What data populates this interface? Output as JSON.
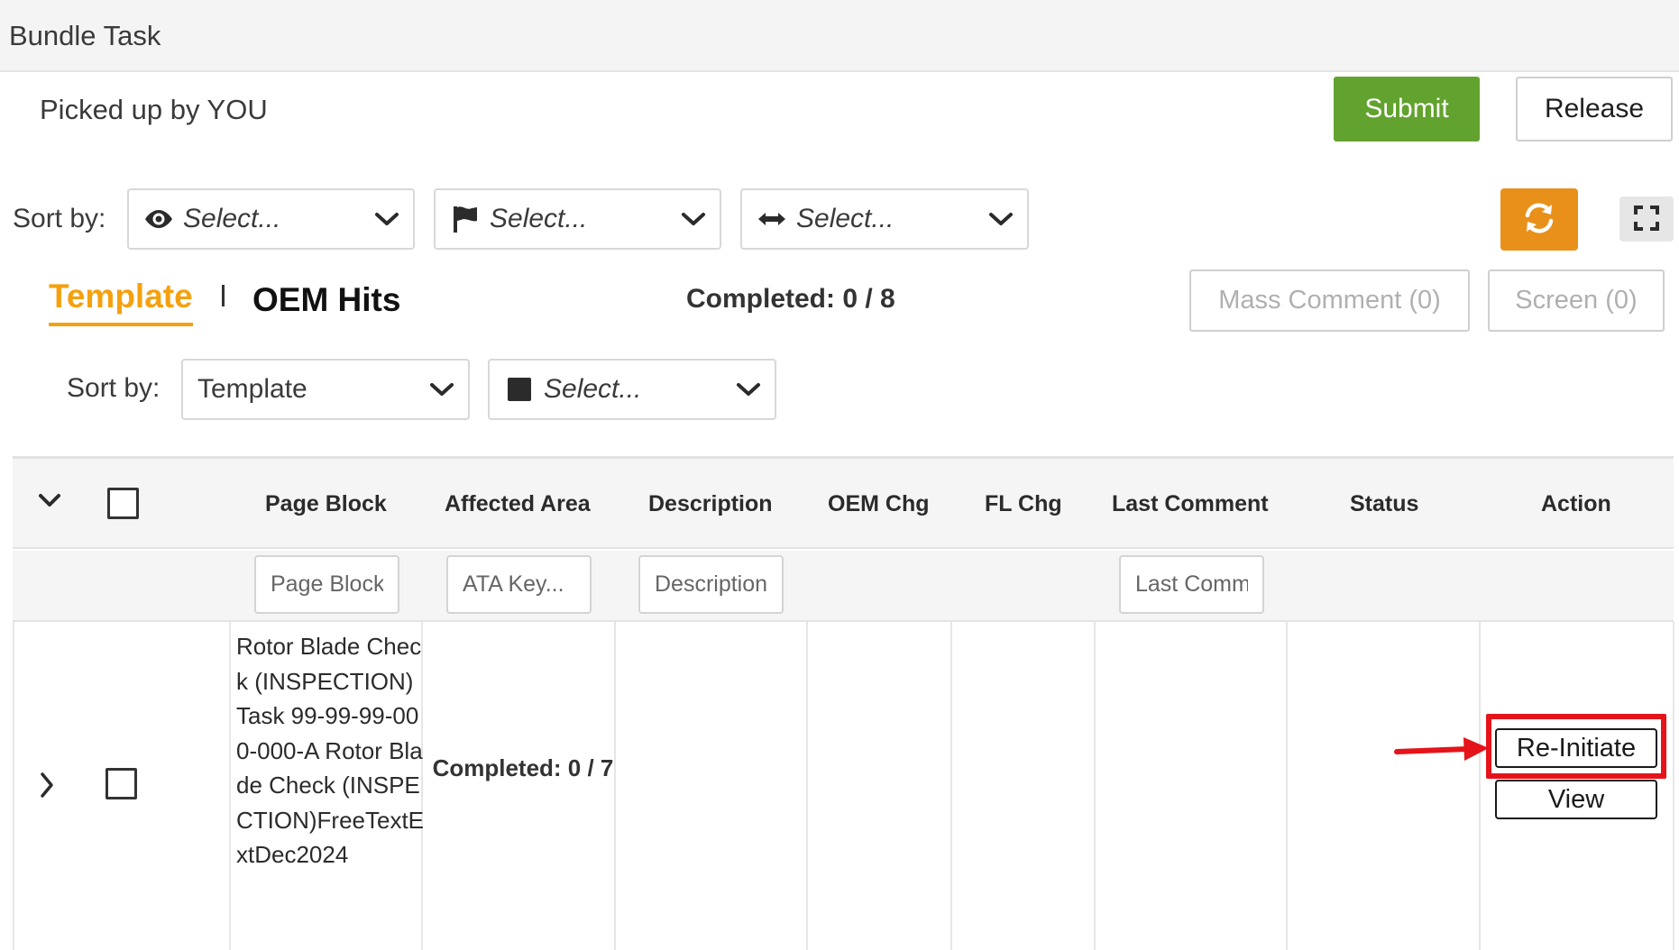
{
  "header": {
    "title": "Bundle Task"
  },
  "status": {
    "picked_up": "Picked up by YOU"
  },
  "actions": {
    "submit": "Submit",
    "release": "Release"
  },
  "sort_top": {
    "label": "Sort by:",
    "selects": [
      {
        "icon": "eye-icon",
        "value": "Select..."
      },
      {
        "icon": "flag-icon",
        "value": "Select..."
      },
      {
        "icon": "horizontal-arrows-icon",
        "value": "Select..."
      }
    ]
  },
  "tabs": [
    {
      "label": "Template",
      "active": true
    },
    {
      "label": "OEM Hits",
      "active": false
    }
  ],
  "completed_summary": "Completed: 0 / 8",
  "bulk_actions": {
    "mass_comment": "Mass Comment (0)",
    "screen": "Screen (0)"
  },
  "sort_secondary": {
    "label": "Sort by:",
    "template_select": "Template",
    "color_select": "Select..."
  },
  "table": {
    "columns": [
      "Page Block",
      "Affected Area",
      "Description",
      "OEM Chg",
      "FL Chg",
      "Last Comment",
      "Status",
      "Action"
    ],
    "filters": {
      "page_block": "Page Block",
      "affected_area": "ATA Key...",
      "description": "Description",
      "last_comment": "Last Comm"
    },
    "rows": [
      {
        "page_block": "Rotor Blade Check (INSPECTION) Task 99-99-99-000-000-A Rotor Blade Check (INSPECTION)FreeTextExtDec2024",
        "affected_area": "Completed: 0 / 7",
        "actions": [
          "Re-Initiate",
          "View"
        ]
      }
    ]
  },
  "accent_colors": {
    "submit": "#62a22e",
    "refresh": "#e8901a",
    "active_tab": "#f5a10f",
    "highlight": "#e4141a"
  }
}
